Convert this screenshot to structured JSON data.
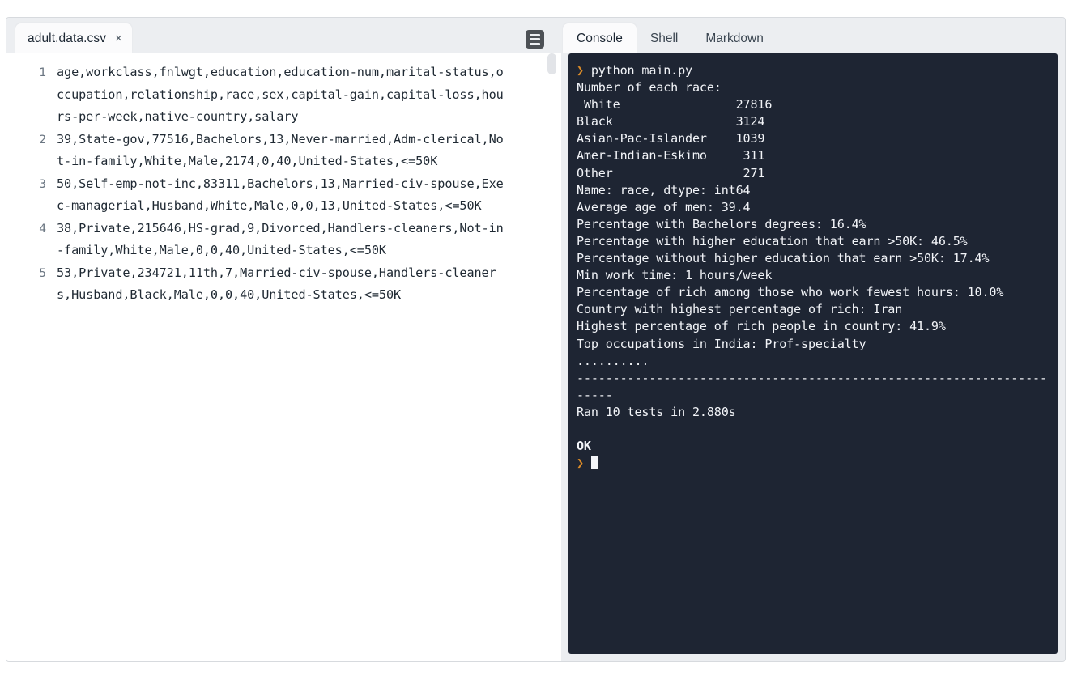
{
  "editor": {
    "tab": {
      "label": "adult.data.csv",
      "close_glyph": "×"
    },
    "toolbar_icon": "text-lines-icon",
    "lines": [
      {
        "number": "1",
        "text": "age,workclass,fnlwgt,education,education-num,marital-status,occupation,relationship,race,sex,capital-gain,capital-loss,hours-per-week,native-country,salary"
      },
      {
        "number": "2",
        "text": "39,State-gov,77516,Bachelors,13,Never-married,Adm-clerical,Not-in-family,White,Male,2174,0,40,United-States,<=50K"
      },
      {
        "number": "3",
        "text": "50,Self-emp-not-inc,83311,Bachelors,13,Married-civ-spouse,Exec-managerial,Husband,White,Male,0,0,13,United-States,<=50K"
      },
      {
        "number": "4",
        "text": "38,Private,215646,HS-grad,9,Divorced,Handlers-cleaners,Not-in-family,White,Male,0,0,40,United-States,<=50K"
      },
      {
        "number": "5",
        "text": "53,Private,234721,11th,7,Married-civ-spouse,Handlers-cleaners,Husband,Black,Male,0,0,40,United-States,<=50K"
      }
    ]
  },
  "console": {
    "tabs": [
      {
        "label": "Console",
        "active": true
      },
      {
        "label": "Shell",
        "active": false
      },
      {
        "label": "Markdown",
        "active": false
      }
    ],
    "prompt_symbol": "❯",
    "command": "python main.py",
    "output": [
      "Number of each race:",
      " White                27816",
      "Black                 3124",
      "Asian-Pac-Islander    1039",
      "Amer-Indian-Eskimo     311",
      "Other                  271",
      "Name: race, dtype: int64",
      "Average age of men: 39.4",
      "Percentage with Bachelors degrees: 16.4%",
      "Percentage with higher education that earn >50K: 46.5%",
      "Percentage without higher education that earn >50K: 17.4%",
      "Min work time: 1 hours/week",
      "Percentage of rich among those who work fewest hours: 10.0%",
      "Country with highest percentage of rich: Iran",
      "Highest percentage of rich people in country: 41.9%",
      "Top occupations in India: Prof-specialty",
      "..........",
      "----------------------------------------------------------------------",
      "Ran 10 tests in 2.880s",
      "",
      "OK"
    ],
    "stats": {
      "race_counts": {
        "White": "27816",
        "Black": "3124",
        "Asian-Pac-Islander": "1039",
        "Amer-Indian-Eskimo": "311",
        "Other": "271"
      },
      "average_age_men": "39.4",
      "percentage_bachelors": "16.4%",
      "higher_education_rich": "46.5%",
      "lower_education_rich": "17.4%",
      "min_work_hours": "1",
      "rich_percentage_min_workers": "10.0%",
      "highest_earning_country": "Iran",
      "highest_earning_country_percentage": "41.9%",
      "top_in_occupation_india": "Prof-specialty",
      "tests_run": "10",
      "tests_duration": "2.880s",
      "tests_result": "OK"
    },
    "colors": {
      "background": "#1e2533",
      "text": "#f2f4f8",
      "prompt": "#d98a28"
    }
  }
}
